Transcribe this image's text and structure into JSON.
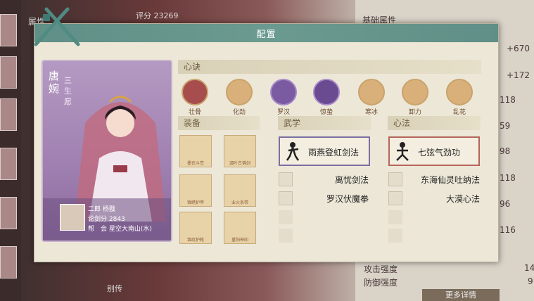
{
  "background": {
    "score_label": "评分",
    "score": "23269",
    "left_tab": "属性",
    "right_header": "基础属性",
    "right_values": [
      "+670",
      "+172",
      "118",
      "59",
      "98",
      "118",
      "96",
      "116"
    ],
    "stats": [
      {
        "label": "攻击强度",
        "value": "14"
      },
      {
        "label": "防御强度",
        "value": "9"
      }
    ],
    "more_button": "更多详情",
    "bottom_tab": "别传"
  },
  "dialog": {
    "title": "配置"
  },
  "card": {
    "name": "唐婉",
    "subtitle": "三生愿",
    "line1": "二郎 杨戬",
    "line2": "论剑分 2843",
    "line3": "帮　会 星空大南山(水)"
  },
  "sections": {
    "mind": "心诀",
    "equip": "装备",
    "martial": "武学",
    "heart": "心法"
  },
  "mind_skills": [
    "壮骨",
    "化劲",
    "罗汉",
    "惊蛰",
    "寒冰",
    "卸力",
    "乱花"
  ],
  "equipment": [
    "墨衣斗笠",
    "迦叶古佛剑",
    "锦绣护甲",
    "业火系带",
    "锦纹护靴",
    "重阳神印"
  ],
  "martial": {
    "main": "雨燕登虹剑法",
    "subs": [
      "离忧剑法",
      "罗汉伏魔拳"
    ]
  },
  "heart": {
    "main": "七弦气劲功",
    "subs": [
      "东海仙灵吐纳法",
      "大漠心法"
    ]
  },
  "colors": {
    "header": "#5f8f86",
    "panel": "#ece7d7",
    "martial_border": "#7a6fa3",
    "heart_border": "#b5645a",
    "card": "#a58bb6"
  }
}
